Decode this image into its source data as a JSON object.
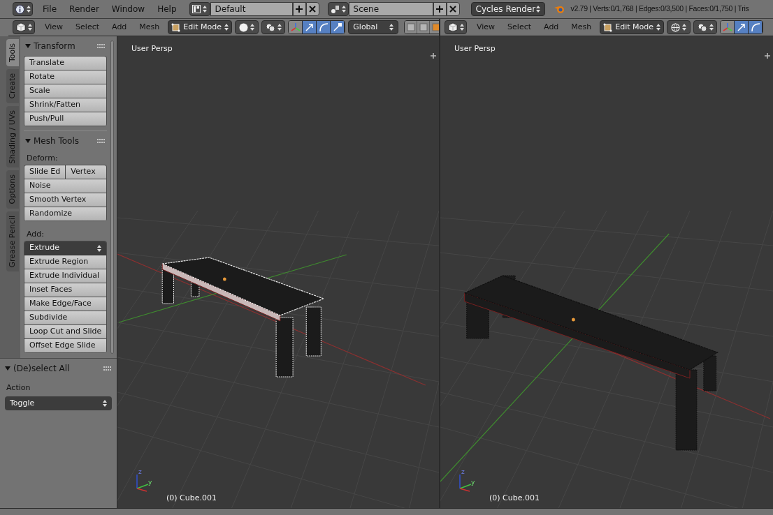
{
  "menubar": {
    "menus": [
      "File",
      "Render",
      "Window",
      "Help"
    ],
    "screen": "Default",
    "scene": "Scene",
    "engine": "Cycles Render",
    "stats": "v2.79 | Verts:0/1,768 | Edges:0/3,500 | Faces:0/1,750 | Tris"
  },
  "viewports": [
    {
      "header": {
        "menus": [
          "View",
          "Select",
          "Add",
          "Mesh"
        ],
        "mode": "Edit Mode",
        "shading": {
          "kind": "solid"
        },
        "manipulators": [
          {
            "kind": "axes",
            "selected": false
          },
          {
            "kind": "move",
            "selected": true
          },
          {
            "kind": "rotate",
            "selected": true
          },
          {
            "kind": "scale",
            "selected": true
          }
        ],
        "orientation": "Global",
        "layers": true
      },
      "label": "User Persp",
      "object": "(0) Cube.001",
      "axes": [
        "z",
        "y"
      ],
      "bench": {
        "kind": "light"
      }
    },
    {
      "header": {
        "menus": [
          "View",
          "Select",
          "Add",
          "Mesh"
        ],
        "mode": "Edit Mode",
        "shading": {
          "kind": "wireframe"
        },
        "manipulators": [
          {
            "kind": "axes",
            "selected": false
          },
          {
            "kind": "move",
            "selected": true
          },
          {
            "kind": "rotate",
            "selected": true
          }
        ],
        "layers": false
      },
      "label": "User Persp",
      "object": "(0) Cube.001",
      "axes": [
        "z",
        "y"
      ],
      "bench": {
        "kind": "dark"
      }
    }
  ],
  "tool_shelf": {
    "tabs": [
      {
        "label": "Tools",
        "selected": true
      },
      {
        "label": "Create",
        "selected": false
      },
      {
        "label": "Shading / UVs",
        "selected": false
      },
      {
        "label": "Options",
        "selected": false
      },
      {
        "label": "Grease Pencil",
        "selected": false
      }
    ],
    "panels": [
      {
        "title": "Transform",
        "expanded": true,
        "sections": [
          {
            "rows": [
              [
                {
                  "label": "Translate",
                  "kind": "button"
                }
              ],
              [
                {
                  "label": "Rotate",
                  "kind": "button"
                }
              ],
              [
                {
                  "label": "Scale",
                  "kind": "button"
                }
              ],
              [
                {
                  "label": "Shrink/Fatten",
                  "kind": "button"
                }
              ],
              [
                {
                  "label": "Push/Pull",
                  "kind": "button"
                }
              ]
            ]
          }
        ]
      },
      {
        "title": "Mesh Tools",
        "expanded": true,
        "sections": [
          {
            "label": "Deform:",
            "rows": [
              [
                {
                  "label": "Slide Ed",
                  "kind": "button"
                },
                {
                  "label": "Vertex",
                  "kind": "button"
                }
              ],
              [
                {
                  "label": "Noise",
                  "kind": "button"
                }
              ],
              [
                {
                  "label": "Smooth Vertex",
                  "kind": "button"
                }
              ],
              [
                {
                  "label": "Randomize",
                  "kind": "button"
                }
              ]
            ]
          },
          {
            "label": "Add:",
            "rows": [
              [
                {
                  "label": "Extrude",
                  "kind": "dropdown"
                }
              ],
              [
                {
                  "label": "Extrude Region",
                  "kind": "button"
                }
              ],
              [
                {
                  "label": "Extrude Individual",
                  "kind": "button"
                }
              ],
              [
                {
                  "label": "Inset Faces",
                  "kind": "button"
                }
              ],
              [
                {
                  "label": "Make Edge/Face",
                  "kind": "button"
                }
              ],
              [
                {
                  "label": "Subdivide",
                  "kind": "button"
                }
              ],
              [
                {
                  "label": "Loop Cut and Slide",
                  "kind": "button"
                }
              ],
              [
                {
                  "label": "Offset Edge Slide",
                  "kind": "button"
                }
              ]
            ]
          }
        ]
      }
    ],
    "operator": {
      "title": "(De)select All",
      "expanded": true,
      "field_label": "Action",
      "value": "Toggle"
    }
  }
}
